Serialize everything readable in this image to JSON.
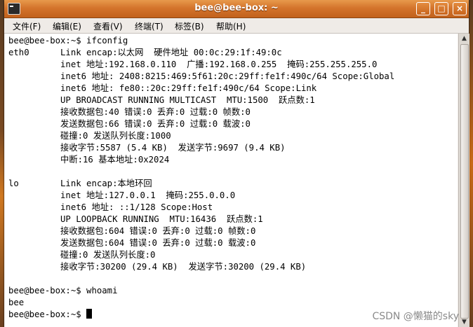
{
  "window": {
    "title": "bee@bee-box: ~",
    "buttons": {
      "minimize": "_",
      "maximize": "□",
      "close": "×"
    }
  },
  "menu": {
    "items": [
      {
        "label": "文件(F)"
      },
      {
        "label": "编辑(E)"
      },
      {
        "label": "查看(V)"
      },
      {
        "label": "终端(T)"
      },
      {
        "label": "标签(B)"
      },
      {
        "label": "帮助(H)"
      }
    ]
  },
  "terminal": {
    "lines": [
      "bee@bee-box:~$ ifconfig",
      "eth0      Link encap:以太网  硬件地址 00:0c:29:1f:49:0c",
      "          inet 地址:192.168.0.110  广播:192.168.0.255  掩码:255.255.255.0",
      "          inet6 地址: 2408:8215:469:5f61:20c:29ff:fe1f:490c/64 Scope:Global",
      "          inet6 地址: fe80::20c:29ff:fe1f:490c/64 Scope:Link",
      "          UP BROADCAST RUNNING MULTICAST  MTU:1500  跃点数:1",
      "          接收数据包:40 错误:0 丢弃:0 过载:0 帧数:0",
      "          发送数据包:66 错误:0 丢弃:0 过载:0 载波:0",
      "          碰撞:0 发送队列长度:1000",
      "          接收字节:5587 (5.4 KB)  发送字节:9697 (9.4 KB)",
      "          中断:16 基本地址:0x2024",
      "",
      "lo        Link encap:本地环回",
      "          inet 地址:127.0.0.1  掩码:255.0.0.0",
      "          inet6 地址: ::1/128 Scope:Host",
      "          UP LOOPBACK RUNNING  MTU:16436  跃点数:1",
      "          接收数据包:604 错误:0 丢弃:0 过载:0 帧数:0",
      "          发送数据包:604 错误:0 丢弃:0 过载:0 载波:0",
      "          碰撞:0 发送队列长度:0",
      "          接收字节:30200 (29.4 KB)  发送字节:30200 (29.4 KB)",
      "",
      "bee@bee-box:~$ whoami",
      "bee",
      "bee@bee-box:~$ "
    ]
  },
  "watermark": "CSDN @懒猫的sky"
}
